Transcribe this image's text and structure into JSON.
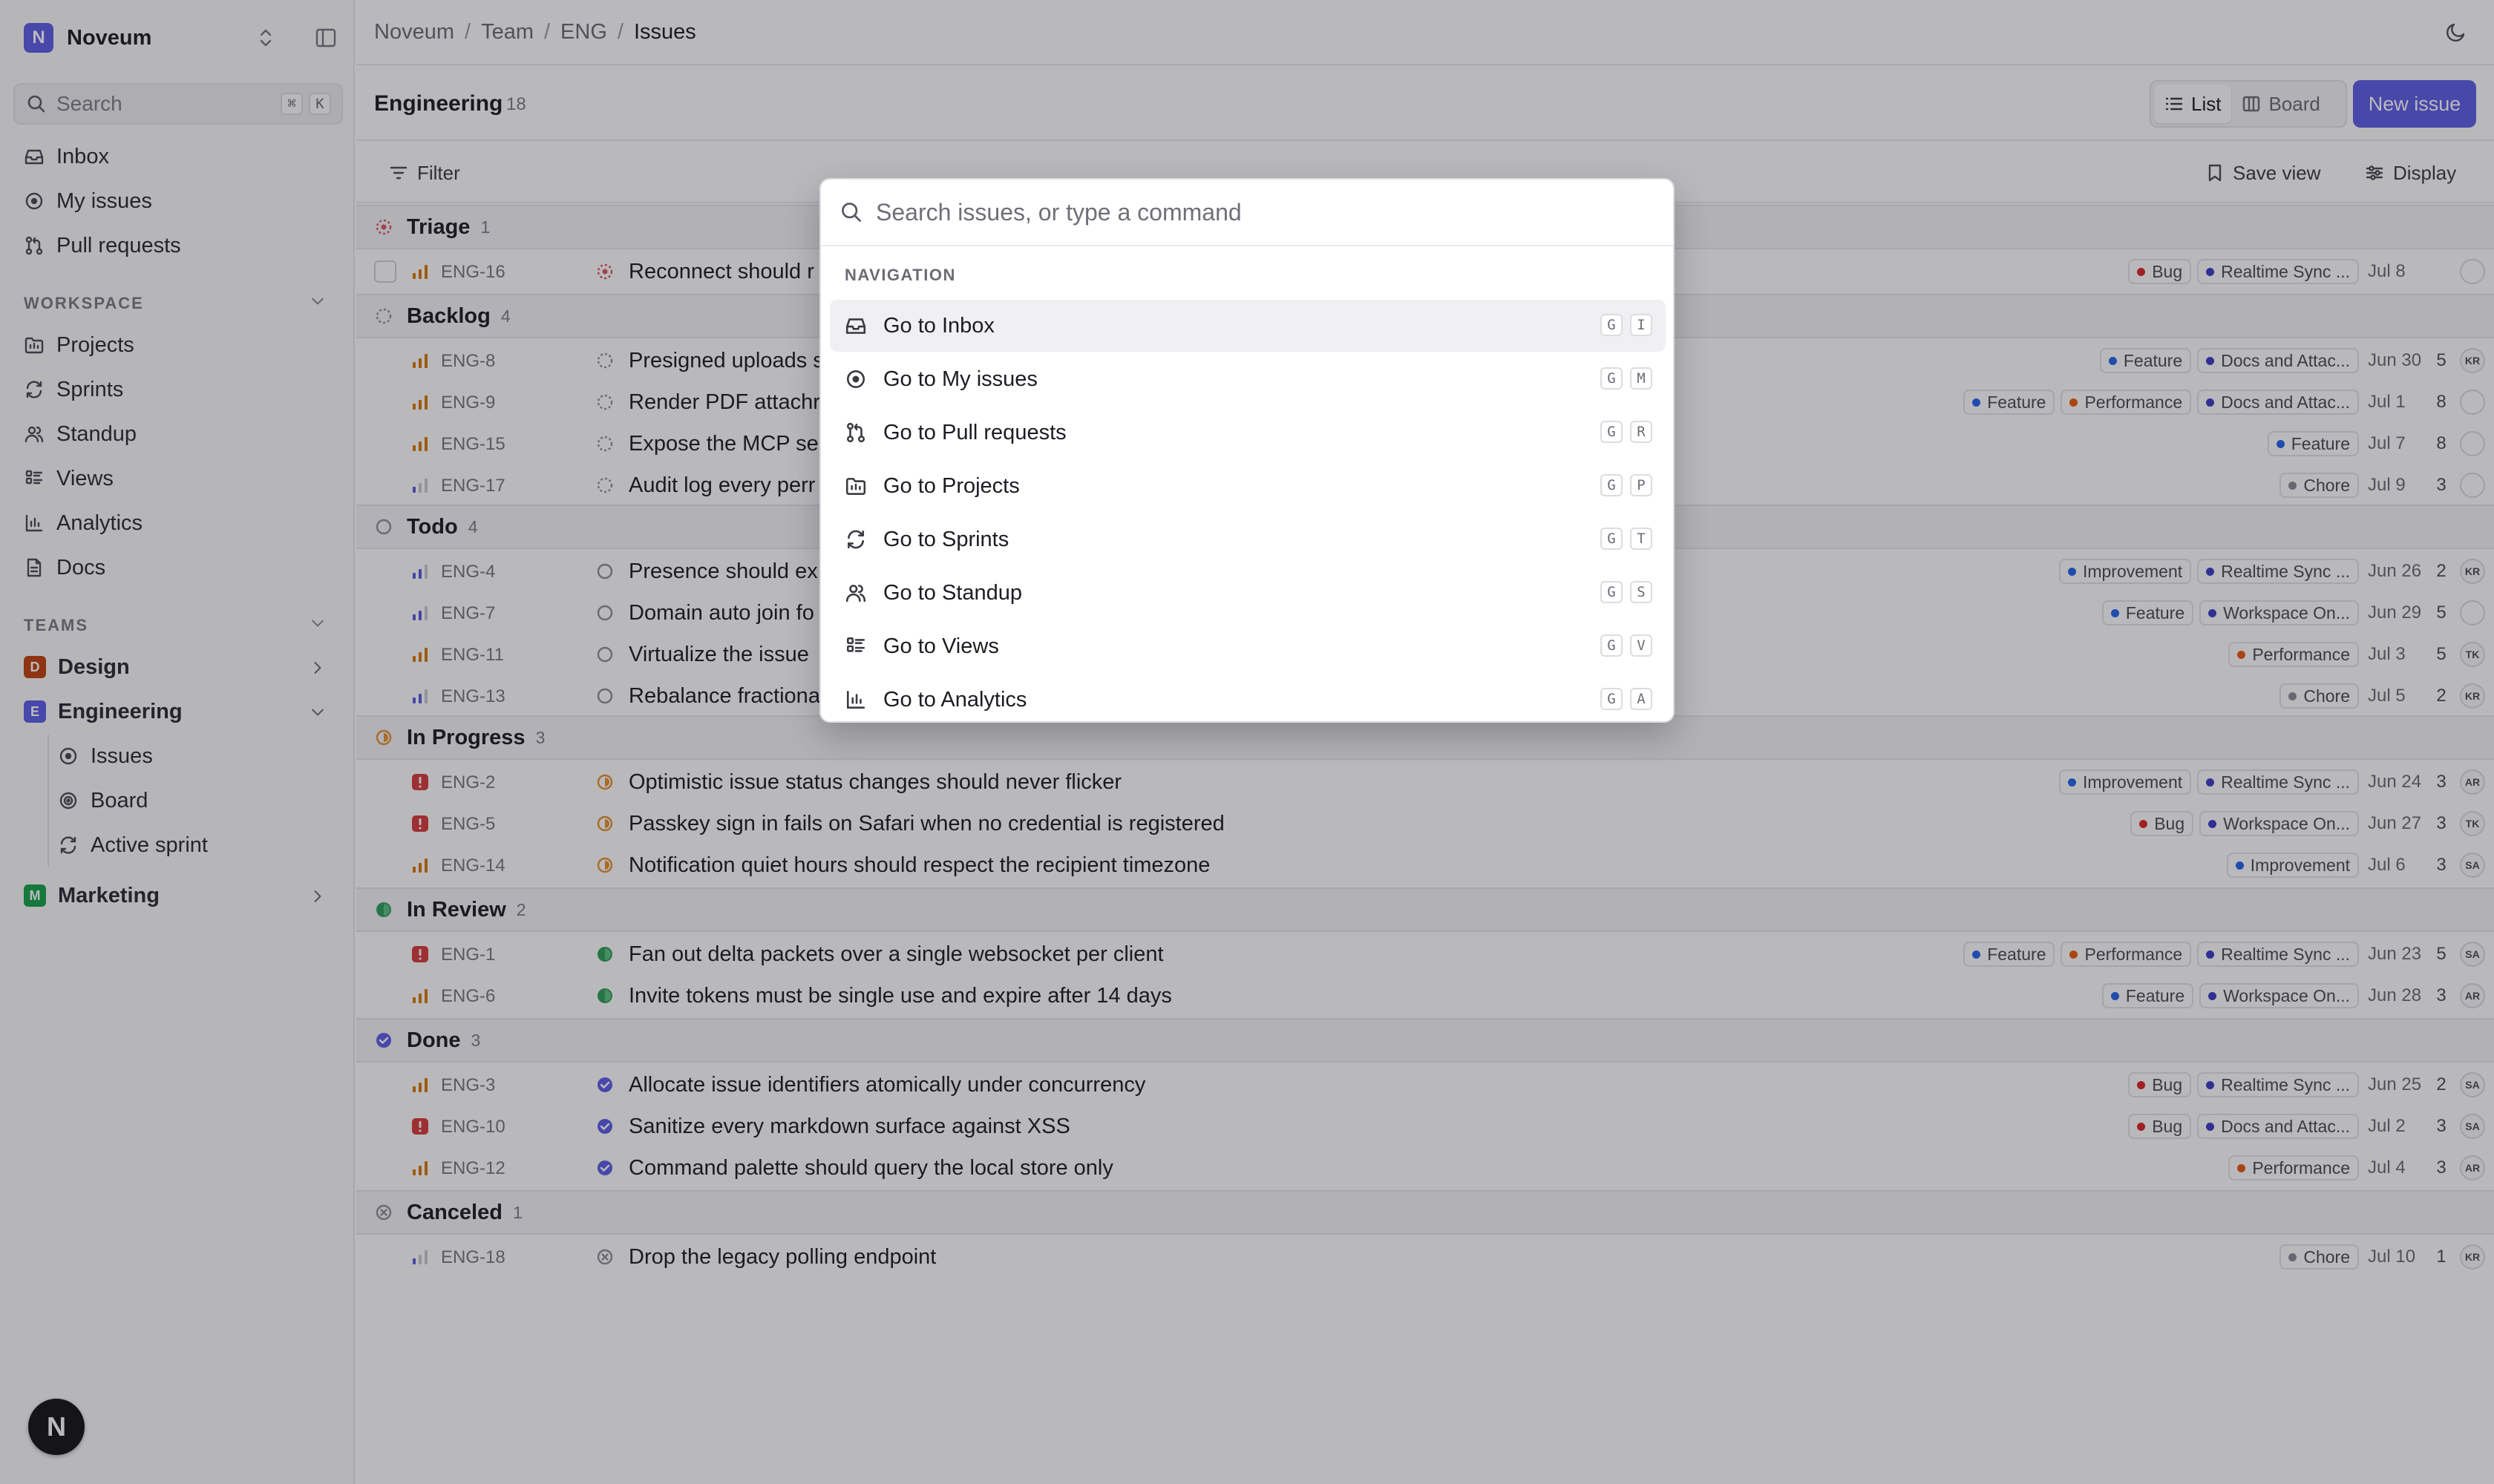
{
  "workspace": {
    "initial": "N",
    "name": "Noveum"
  },
  "sidebar": {
    "search_placeholder": "Search",
    "search_keys": [
      "⌘",
      "K"
    ],
    "primary": [
      {
        "label": "Inbox",
        "icon": "inbox-icon"
      },
      {
        "label": "My issues",
        "icon": "my-issues-icon"
      },
      {
        "label": "Pull requests",
        "icon": "pull-request-icon"
      }
    ],
    "workspace_label": "WORKSPACE",
    "workspace_items": [
      {
        "label": "Projects",
        "icon": "folder-icon"
      },
      {
        "label": "Sprints",
        "icon": "sprint-icon"
      },
      {
        "label": "Standup",
        "icon": "users-icon"
      },
      {
        "label": "Views",
        "icon": "views-icon"
      },
      {
        "label": "Analytics",
        "icon": "analytics-icon"
      },
      {
        "label": "Docs",
        "icon": "doc-icon"
      }
    ],
    "teams_label": "TEAMS",
    "teams": [
      {
        "initial": "D",
        "name": "Design",
        "color": "#c2410c"
      },
      {
        "initial": "E",
        "name": "Engineering",
        "color": "#5e5ce6"
      },
      {
        "initial": "M",
        "name": "Marketing",
        "color": "#16a34a"
      }
    ],
    "engineering_items": [
      {
        "label": "Issues",
        "icon": "issues-icon"
      },
      {
        "label": "Board",
        "icon": "board-icon"
      },
      {
        "label": "Active sprint",
        "icon": "sprint-icon"
      }
    ],
    "fab_letter": "N"
  },
  "breadcrumb": [
    "Noveum",
    "Team",
    "ENG",
    "Issues"
  ],
  "team_header": {
    "title": "Engineering",
    "count": "18",
    "list_label": "List",
    "board_label": "Board",
    "new_issue_label": "New issue"
  },
  "filterbar": {
    "filter_label": "Filter",
    "save_view_label": "Save view",
    "display_label": "Display"
  },
  "colors": {
    "accent": "#5e5ce6",
    "bug": "#dc2626",
    "feature": "#2563eb",
    "performance": "#ea580c",
    "improvement": "#2563eb",
    "chore": "#8a8a92",
    "realtime": "#3b3bc4",
    "docs": "#3b3bc4",
    "workspace": "#3b3bc4"
  },
  "groups": [
    {
      "name": "Triage",
      "count": "1",
      "status": "triage",
      "issues": [
        {
          "id": "ENG-16",
          "title": "Reconnect should r",
          "priority": "high",
          "labels": [
            {
              "text": "Bug",
              "color": "#dc2626"
            },
            {
              "text": "Realtime Sync ...",
              "color": "#3b3bc4"
            }
          ],
          "due": "Jul 8",
          "estimate": "",
          "assignee": ""
        }
      ]
    },
    {
      "name": "Backlog",
      "count": "4",
      "status": "backlog",
      "issues": [
        {
          "id": "ENG-8",
          "title": "Presigned uploads s",
          "priority": "high",
          "labels": [
            {
              "text": "Feature",
              "color": "#2563eb"
            },
            {
              "text": "Docs and Attac...",
              "color": "#3b3bc4"
            }
          ],
          "due": "Jun 30",
          "estimate": "5",
          "assignee": "KR"
        },
        {
          "id": "ENG-9",
          "title": "Render PDF attachr",
          "priority": "high",
          "labels": [
            {
              "text": "Feature",
              "color": "#2563eb"
            },
            {
              "text": "Performance",
              "color": "#ea580c"
            },
            {
              "text": "Docs and Attac...",
              "color": "#3b3bc4"
            }
          ],
          "due": "Jul 1",
          "estimate": "8",
          "assignee": ""
        },
        {
          "id": "ENG-15",
          "title": "Expose the MCP se",
          "priority": "high",
          "labels": [
            {
              "text": "Feature",
              "color": "#2563eb"
            }
          ],
          "due": "Jul 7",
          "estimate": "8",
          "assignee": ""
        },
        {
          "id": "ENG-17",
          "title": "Audit log every perr",
          "priority": "low",
          "labels": [
            {
              "text": "Chore",
              "color": "#8a8a92"
            }
          ],
          "due": "Jul 9",
          "estimate": "3",
          "assignee": ""
        }
      ]
    },
    {
      "name": "Todo",
      "count": "4",
      "status": "todo",
      "issues": [
        {
          "id": "ENG-4",
          "title": "Presence should ex",
          "priority": "medium",
          "labels": [
            {
              "text": "Improvement",
              "color": "#2563eb"
            },
            {
              "text": "Realtime Sync ...",
              "color": "#3b3bc4"
            }
          ],
          "due": "Jun 26",
          "estimate": "2",
          "assignee": "KR"
        },
        {
          "id": "ENG-7",
          "title": "Domain auto join fo",
          "priority": "medium",
          "labels": [
            {
              "text": "Feature",
              "color": "#2563eb"
            },
            {
              "text": "Workspace On...",
              "color": "#3b3bc4"
            }
          ],
          "due": "Jun 29",
          "estimate": "5",
          "assignee": ""
        },
        {
          "id": "ENG-11",
          "title": "Virtualize the issue",
          "priority": "high",
          "labels": [
            {
              "text": "Performance",
              "color": "#ea580c"
            }
          ],
          "due": "Jul 3",
          "estimate": "5",
          "assignee": "TK"
        },
        {
          "id": "ENG-13",
          "title": "Rebalance fractiona",
          "priority": "medium",
          "labels": [
            {
              "text": "Chore",
              "color": "#8a8a92"
            }
          ],
          "due": "Jul 5",
          "estimate": "2",
          "assignee": "KR"
        }
      ]
    },
    {
      "name": "In Progress",
      "count": "3",
      "status": "progress",
      "issues": [
        {
          "id": "ENG-2",
          "title": "Optimistic issue status changes should never flicker",
          "priority": "urgent",
          "labels": [
            {
              "text": "Improvement",
              "color": "#2563eb"
            },
            {
              "text": "Realtime Sync ...",
              "color": "#3b3bc4"
            }
          ],
          "due": "Jun 24",
          "estimate": "3",
          "assignee": "AR"
        },
        {
          "id": "ENG-5",
          "title": "Passkey sign in fails on Safari when no credential is registered",
          "priority": "urgent",
          "labels": [
            {
              "text": "Bug",
              "color": "#dc2626"
            },
            {
              "text": "Workspace On...",
              "color": "#3b3bc4"
            }
          ],
          "due": "Jun 27",
          "estimate": "3",
          "assignee": "TK"
        },
        {
          "id": "ENG-14",
          "title": "Notification quiet hours should respect the recipient timezone",
          "priority": "high",
          "labels": [
            {
              "text": "Improvement",
              "color": "#2563eb"
            }
          ],
          "due": "Jul 6",
          "estimate": "3",
          "assignee": "SA"
        }
      ]
    },
    {
      "name": "In Review",
      "count": "2",
      "status": "review",
      "issues": [
        {
          "id": "ENG-1",
          "title": "Fan out delta packets over a single websocket per client",
          "priority": "urgent",
          "labels": [
            {
              "text": "Feature",
              "color": "#2563eb"
            },
            {
              "text": "Performance",
              "color": "#ea580c"
            },
            {
              "text": "Realtime Sync ...",
              "color": "#3b3bc4"
            }
          ],
          "due": "Jun 23",
          "estimate": "5",
          "assignee": "SA"
        },
        {
          "id": "ENG-6",
          "title": "Invite tokens must be single use and expire after 14 days",
          "priority": "high",
          "labels": [
            {
              "text": "Feature",
              "color": "#2563eb"
            },
            {
              "text": "Workspace On...",
              "color": "#3b3bc4"
            }
          ],
          "due": "Jun 28",
          "estimate": "3",
          "assignee": "AR"
        }
      ]
    },
    {
      "name": "Done",
      "count": "3",
      "status": "done",
      "issues": [
        {
          "id": "ENG-3",
          "title": "Allocate issue identifiers atomically under concurrency",
          "priority": "high",
          "labels": [
            {
              "text": "Bug",
              "color": "#dc2626"
            },
            {
              "text": "Realtime Sync ...",
              "color": "#3b3bc4"
            }
          ],
          "due": "Jun 25",
          "estimate": "2",
          "assignee": "SA"
        },
        {
          "id": "ENG-10",
          "title": "Sanitize every markdown surface against XSS",
          "priority": "urgent",
          "labels": [
            {
              "text": "Bug",
              "color": "#dc2626"
            },
            {
              "text": "Docs and Attac...",
              "color": "#3b3bc4"
            }
          ],
          "due": "Jul 2",
          "estimate": "3",
          "assignee": "SA"
        },
        {
          "id": "ENG-12",
          "title": "Command palette should query the local store only",
          "priority": "high",
          "labels": [
            {
              "text": "Performance",
              "color": "#ea580c"
            }
          ],
          "due": "Jul 4",
          "estimate": "3",
          "assignee": "AR"
        }
      ]
    },
    {
      "name": "Canceled",
      "count": "1",
      "status": "canceled",
      "issues": [
        {
          "id": "ENG-18",
          "title": "Drop the legacy polling endpoint",
          "priority": "low",
          "labels": [
            {
              "text": "Chore",
              "color": "#8a8a92"
            }
          ],
          "due": "Jul 10",
          "estimate": "1",
          "assignee": "KR"
        }
      ]
    }
  ],
  "palette": {
    "placeholder": "Search issues, or type a command",
    "section": "NAVIGATION",
    "items": [
      {
        "label": "Go to Inbox",
        "keys": [
          "G",
          "I"
        ],
        "icon": "inbox-icon",
        "active": true
      },
      {
        "label": "Go to My issues",
        "keys": [
          "G",
          "M"
        ],
        "icon": "my-issues-icon"
      },
      {
        "label": "Go to Pull requests",
        "keys": [
          "G",
          "R"
        ],
        "icon": "pull-request-icon"
      },
      {
        "label": "Go to Projects",
        "keys": [
          "G",
          "P"
        ],
        "icon": "folder-icon"
      },
      {
        "label": "Go to Sprints",
        "keys": [
          "G",
          "T"
        ],
        "icon": "sprint-icon"
      },
      {
        "label": "Go to Standup",
        "keys": [
          "G",
          "S"
        ],
        "icon": "users-icon"
      },
      {
        "label": "Go to Views",
        "keys": [
          "G",
          "V"
        ],
        "icon": "views-icon"
      },
      {
        "label": "Go to Analytics",
        "keys": [
          "G",
          "A"
        ],
        "icon": "analytics-icon"
      }
    ]
  }
}
